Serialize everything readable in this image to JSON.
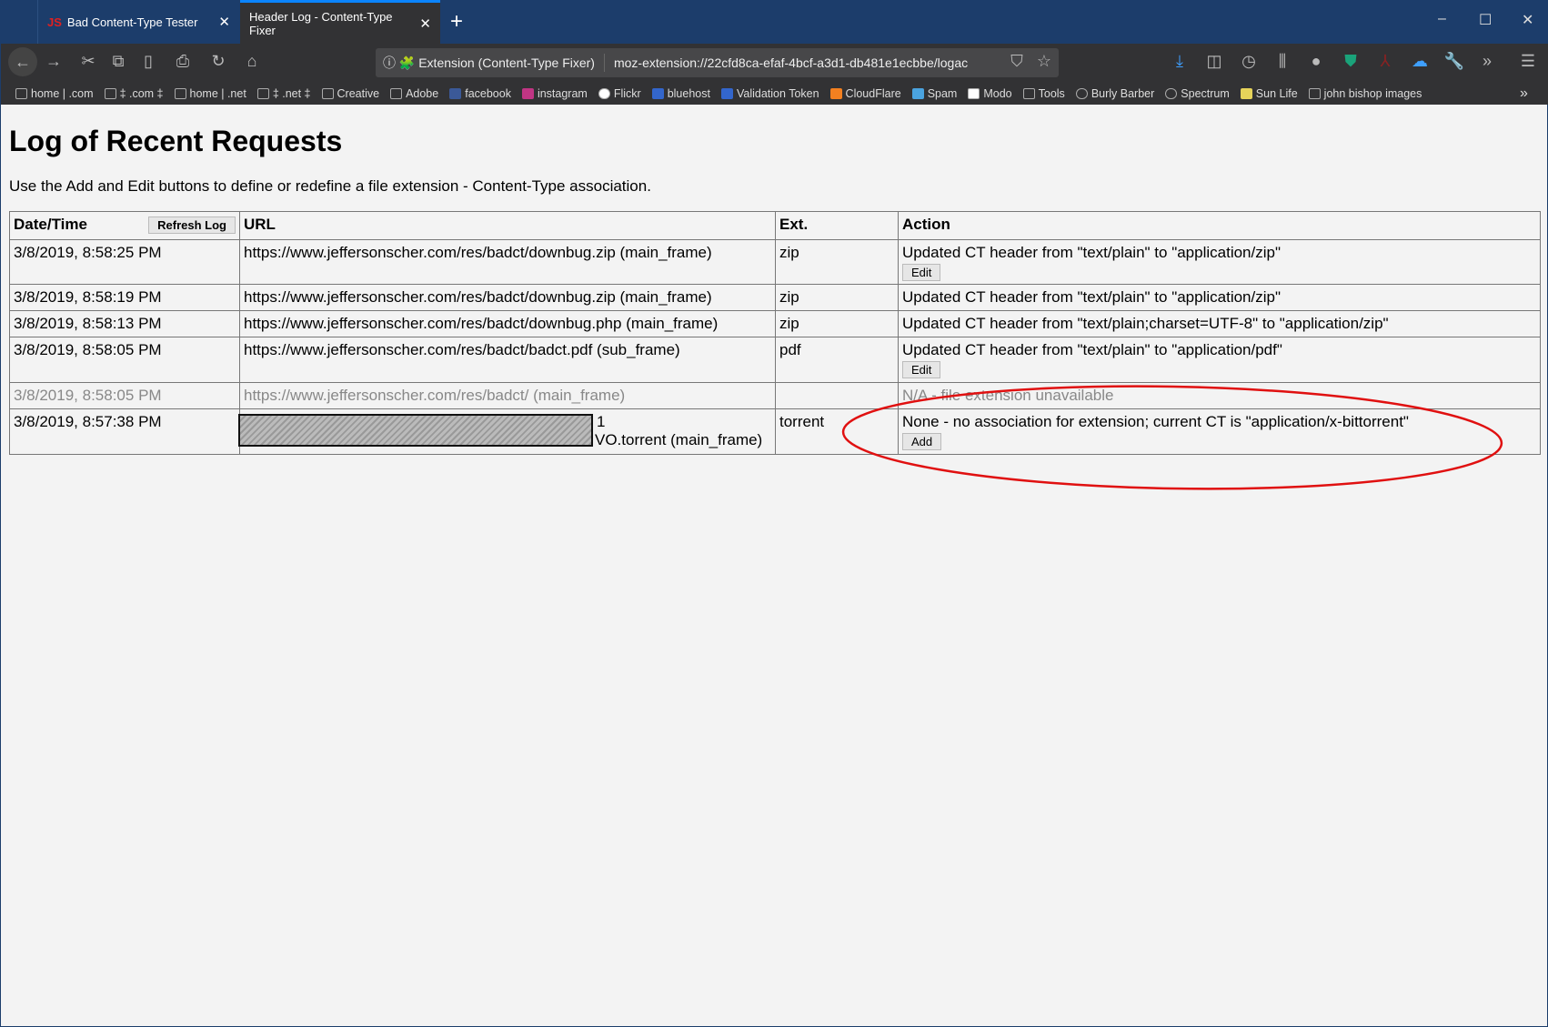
{
  "browser": {
    "tabs": [
      {
        "label": "Bad Content-Type Tester",
        "icon": "JS"
      },
      {
        "label": "Header Log - Content-Type Fixer",
        "active": true
      }
    ],
    "url_identity": "Extension (Content-Type Fixer)",
    "url": "moz-extension://22cfd8ca-efaf-4bcf-a3d1-db481e1ecbbe/logac",
    "bookmarks": [
      "home | .com",
      "‡ .com ‡",
      "home | .net",
      "‡ .net ‡",
      "Creative",
      "Adobe",
      "facebook",
      "instagram",
      "Flickr",
      "bluehost",
      "Validation Token",
      "CloudFlare",
      "Spam",
      "Modo",
      "Tools",
      "Burly Barber",
      "Spectrum",
      "Sun Life",
      "john bishop images"
    ],
    "accent": "#0a84ff"
  },
  "page": {
    "title": "Log of Recent Requests",
    "description": "Use the Add and Edit buttons to define or redefine a file extension - Content-Type association.",
    "headers": {
      "datetime": "Date/Time",
      "refresh": "Refresh Log",
      "url": "URL",
      "ext": "Ext.",
      "action": "Action"
    },
    "rows": [
      {
        "datetime": "3/8/2019, 8:58:25 PM",
        "url": "https://www.jeffersonscher.com/res/badct/downbug.zip (main_frame)",
        "ext": "zip",
        "action": "Updated CT header from \"text/plain\" to \"application/zip\"",
        "button": "Edit"
      },
      {
        "datetime": "3/8/2019, 8:58:19 PM",
        "url": "https://www.jeffersonscher.com/res/badct/downbug.zip (main_frame)",
        "ext": "zip",
        "action": "Updated CT header from \"text/plain\" to \"application/zip\""
      },
      {
        "datetime": "3/8/2019, 8:58:13 PM",
        "url": "https://www.jeffersonscher.com/res/badct/downbug.php (main_frame)",
        "ext": "zip",
        "action": "Updated CT header from \"text/plain;charset=UTF-8\" to \"application/zip\""
      },
      {
        "datetime": "3/8/2019, 8:58:05 PM",
        "url": "https://www.jeffersonscher.com/res/badct/badct.pdf (sub_frame)",
        "ext": "pdf",
        "action": "Updated CT header from \"text/plain\" to \"application/pdf\"",
        "button": "Edit"
      },
      {
        "datetime": "3/8/2019, 8:58:05 PM",
        "url": "https://www.jeffersonscher.com/res/badct/ (main_frame)",
        "ext": "",
        "action": "N/A - file extension unavailable",
        "dim": true
      },
      {
        "datetime": "3/8/2019, 8:57:38 PM",
        "url_line1": "1",
        "url_line2": "VO.torrent (main_frame)",
        "ext": "torrent",
        "action": "None - no association for extension; current CT is \"application/x-bittorrent\"",
        "button": "Add"
      }
    ],
    "annotation_color": "#e01010"
  }
}
